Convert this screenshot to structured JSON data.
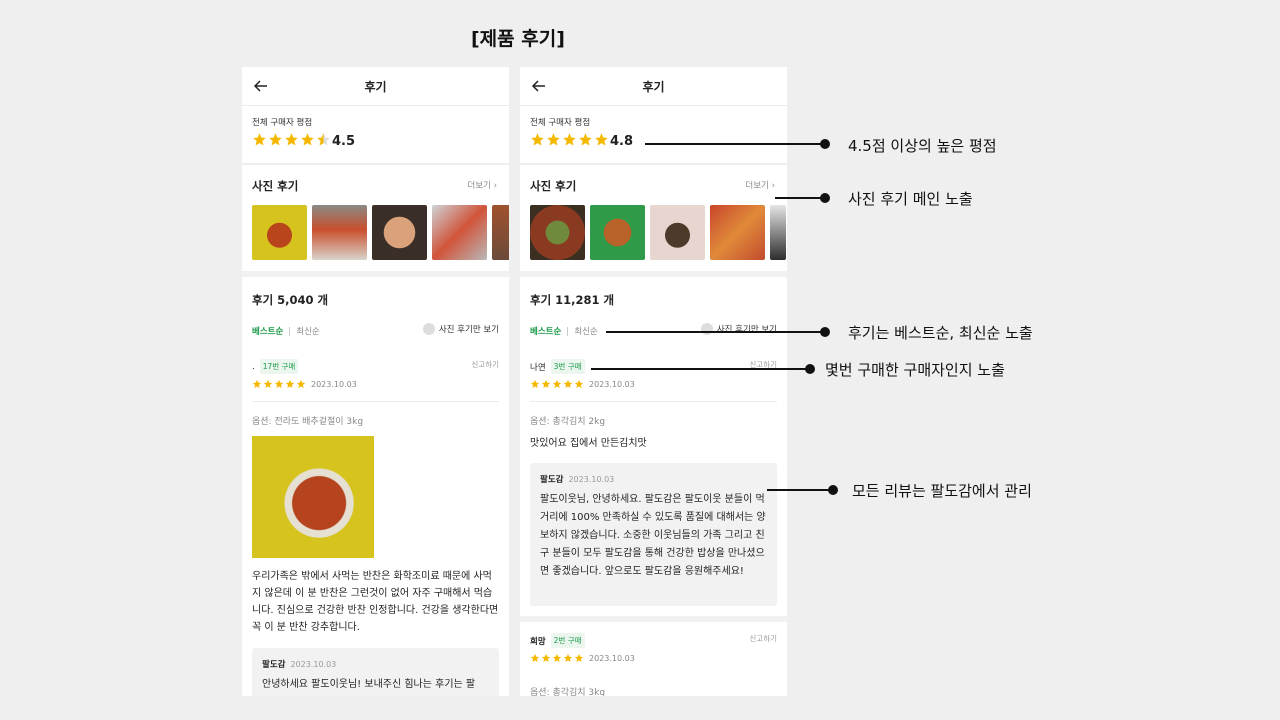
{
  "page_title": "[제품 후기]",
  "colors": {
    "accent_green": "#1c9a4a",
    "star": "#f5b800"
  },
  "left": {
    "header_title": "후기",
    "rating_label": "전체 구매자 평점",
    "rating_score": "4.5",
    "photo_title": "사진 후기",
    "more": "더보기",
    "count": "후기 5,040 개",
    "sort_best": "베스트순",
    "sort_recent": "최신순",
    "photo_only": "사진 후기만 보기",
    "review": {
      "name": ".",
      "badge": "17번 구매",
      "report": "신고하기",
      "date": "2023.10.03",
      "option": "옵션: 전라도 배추겉절이 3kg",
      "body": "우리가족은 밖에서 사먹는 반찬은 화학조미료 때문에 사먹지 않은데 이 분 반찬은 그런것이 없어 자주 구매해서 먹습니다. 진심으로 건강한 반찬 인정합니다. 건강을 생각한다면 꼭 이 분 반찬 강추합니다.",
      "reply_name": "팔도감",
      "reply_date": "2023.10.03",
      "reply_text": "안녕하세요 팔도이웃님! 보내주신 힘나는 후기는 팔"
    }
  },
  "right": {
    "header_title": "후기",
    "rating_label": "전체 구매자 평점",
    "rating_score": "4.8",
    "photo_title": "사진 후기",
    "more": "더보기",
    "count": "후기 11,281 개",
    "sort_best": "베스트순",
    "sort_recent": "최신순",
    "photo_only": "사진 후기만 보기",
    "review": {
      "name": "나연",
      "badge": "3번 구매",
      "report": "신고하기",
      "date": "2023.10.03",
      "option": "옵션: 총각김치 2kg",
      "body": "맛있어요 집에서 만든김치맛",
      "reply_name": "팔도감",
      "reply_date": "2023.10.03",
      "reply_text": "팔도이웃님, 안녕하세요. 팔도감은 팔도이웃 분들이 먹거리에 100% 만족하실 수 있도록 품질에 대해서는 양보하지 않겠습니다. 소중한 이웃님들의 가족 그리고 친구 분들이 모두 팔도감을 통해 건강한 밥상을 만나셨으면 좋겠습니다. 앞으로도 팔도감을 응원해주세요!"
    },
    "review2": {
      "name": "희망",
      "badge": "2번 구매",
      "report": "신고하기",
      "date": "2023.10.03",
      "option": "옵션: 총각김치 3kg"
    }
  },
  "annotations": [
    "4.5점 이상의 높은 평점",
    "사진 후기 메인 노출",
    "후기는 베스트순, 최신순 노출",
    "몇번 구매한 구매자인지 노출",
    "모든 리뷰는 팔도감에서 관리"
  ]
}
